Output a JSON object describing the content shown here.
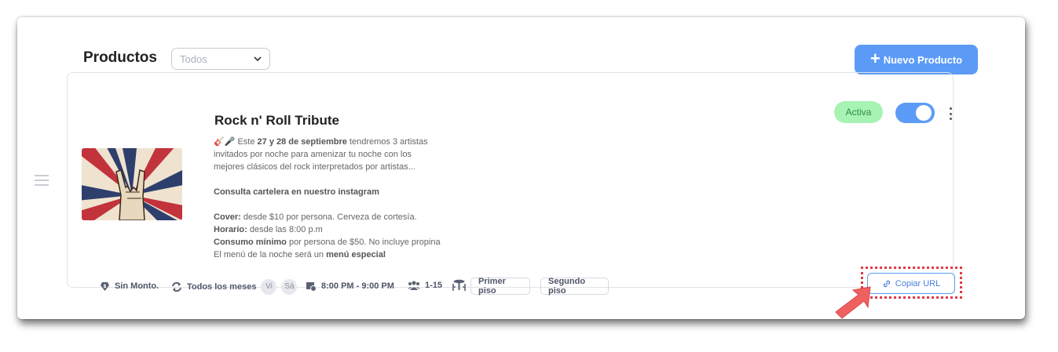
{
  "header": {
    "title": "Productos",
    "filter_value": "Todos",
    "new_button_label": "Nuevo Producto"
  },
  "product": {
    "name": "Rock n' Roll Tribute",
    "status": "Activa",
    "enabled": true,
    "description": {
      "intro_emoji": "🎸🎤",
      "intro_pre": " Este ",
      "intro_bold": "27 y 28 de septiembre",
      "intro_post": " tendremos 3 artistas",
      "line2": "invitados por noche para amenizar tu noche con los",
      "line3": "mejores clásicos del rock interpretados por artistas...",
      "cartelera": "Consulta cartelera en nuestro instagram",
      "cover_label": "Cover:",
      "cover_text": " desde $10 por persona. Cerveza de cortesía.",
      "horario_label": "Horario:",
      "horario_text": " desde las 8:00 p.m",
      "consumo_label": "Consumo mínimo",
      "consumo_text": " por persona de $50. No incluye propina",
      "menu_pre": "El menú de la noche será un ",
      "menu_bold": "menú especial"
    },
    "meta": {
      "amount": "Sin Monto.",
      "recurrence": "Todos los meses",
      "days": [
        "Vi",
        "Sá"
      ],
      "time": "8:00 PM - 9:00 PM",
      "people": "1-15",
      "areas": [
        "Primer piso",
        "Segundo piso"
      ]
    },
    "copy_url_label": "Copiar URL"
  },
  "colors": {
    "accent": "#5b9bf7",
    "status_bg": "#a7f3b3",
    "status_text": "#2f8a45",
    "highlight": "#e03a45"
  },
  "icons": [
    "chevron-down-icon",
    "plus-icon",
    "drag-handle-icon",
    "kebab-menu-icon",
    "money-tag-icon",
    "repeat-icon",
    "calendar-clock-icon",
    "users-icon",
    "table-icon",
    "link-icon",
    "pointer-arrow-icon"
  ]
}
